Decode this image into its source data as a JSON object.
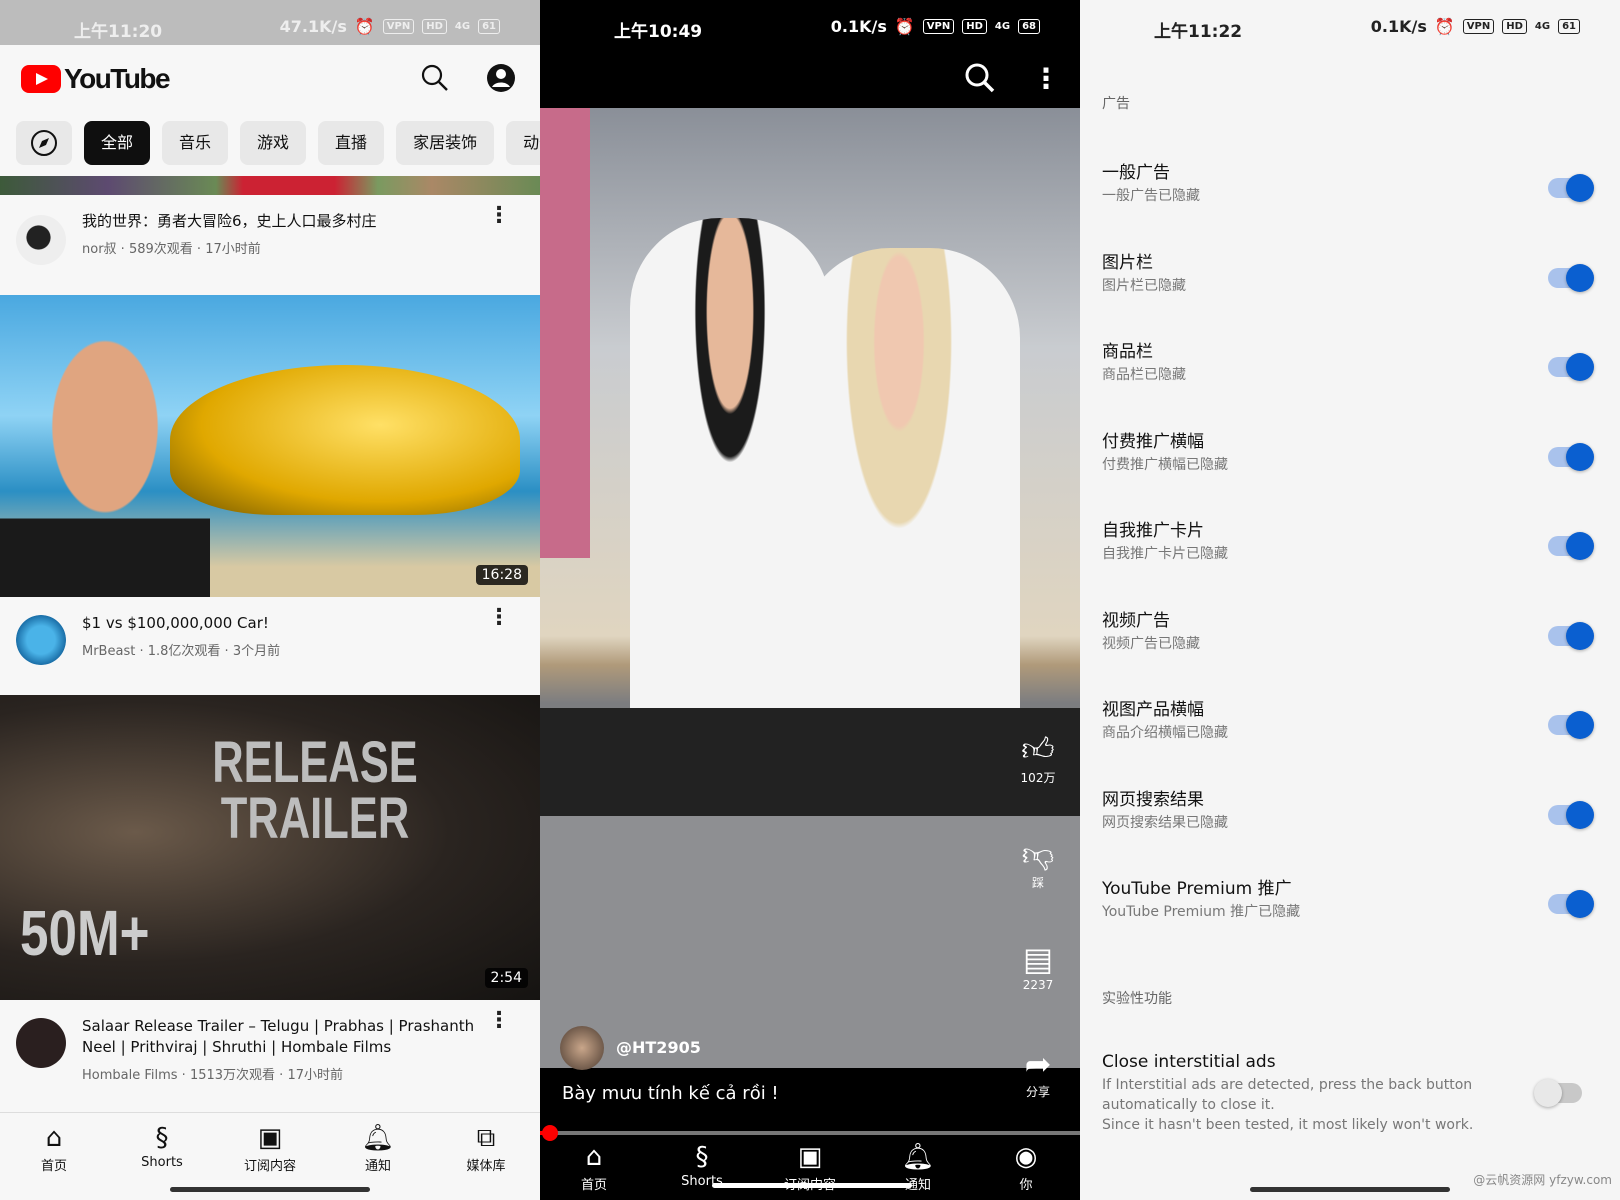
{
  "home": {
    "status": {
      "time": "上午11:20",
      "speed": "47.1K/s",
      "vpn": "VPN",
      "hd": "HD",
      "net": "4G",
      "battery": "61"
    },
    "app_title": "YouTube",
    "chips": [
      "全部",
      "音乐",
      "游戏",
      "直播",
      "家居装饰",
      "动作"
    ],
    "videos": [
      {
        "title": "我的世界：勇者大冒险6，史上人口最多村庄",
        "channel": "nor叔",
        "views": "589次观看",
        "age": "17小时前"
      },
      {
        "title": "$1 vs $100,000,000 Car!",
        "channel": "MrBeast",
        "views": "1.8亿次观看",
        "age": "3个月前",
        "duration": "16:28"
      },
      {
        "title": "Salaar Release Trailer – Telugu | Prabhas | Prashanth Neel | Prithviraj | Shruthi | Hombale Films",
        "channel": "Hombale Films",
        "views": "1513万次观看",
        "age": "17小时前",
        "duration": "2:54",
        "thumb_text": "RELEASE TRAILER",
        "thumb_badge": "50M+"
      }
    ],
    "nav": [
      "首页",
      "Shorts",
      "订阅内容",
      "通知",
      "媒体库"
    ]
  },
  "shorts": {
    "status": {
      "time": "上午10:49",
      "speed": "0.1K/s",
      "vpn": "VPN",
      "hd": "HD",
      "net": "4G",
      "battery": "68"
    },
    "likes": "102万",
    "dislike": "踩",
    "comments": "2237",
    "share": "分享",
    "channel": "@HT2905",
    "caption": "Bày mưu tính kế cả rồi !",
    "progress": 0.01,
    "nav": [
      "首页",
      "Shorts",
      "订阅内容",
      "通知",
      "你"
    ]
  },
  "settings": {
    "status": {
      "time": "上午11:22",
      "speed": "0.1K/s",
      "vpn": "VPN",
      "hd": "HD",
      "net": "4G",
      "battery": "61"
    },
    "section_ads": "广告",
    "items": [
      {
        "title": "一般广告",
        "sub": "一般广告已隐藏",
        "on": true
      },
      {
        "title": "图片栏",
        "sub": "图片栏已隐藏",
        "on": true
      },
      {
        "title": "商品栏",
        "sub": "商品栏已隐藏",
        "on": true
      },
      {
        "title": "付费推广横幅",
        "sub": "付费推广横幅已隐藏",
        "on": true
      },
      {
        "title": "自我推广卡片",
        "sub": "自我推广卡片已隐藏",
        "on": true
      },
      {
        "title": "视频广告",
        "sub": "视频广告已隐藏",
        "on": true
      },
      {
        "title": "视图产品横幅",
        "sub": "商品介绍横幅已隐藏",
        "on": true
      },
      {
        "title": "网页搜索结果",
        "sub": "网页搜索结果已隐藏",
        "on": true
      },
      {
        "title": "YouTube Premium 推广",
        "sub": "YouTube Premium 推广已隐藏",
        "on": true
      }
    ],
    "section_exp": "实验性功能",
    "exp": {
      "title": "Close interstitial ads",
      "sub": "If Interstitial ads are detected, press the back button automatically to close it.",
      "sub2": "Since it hasn't been tested, it most likely won't work.",
      "on": false
    },
    "watermark": "@云帆资源网 yfzyw.com",
    "accent": "#0a5fd0"
  }
}
